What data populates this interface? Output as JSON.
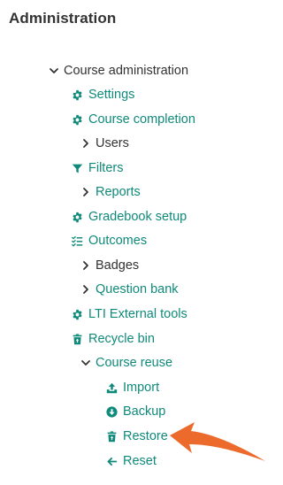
{
  "block": {
    "title": "Administration"
  },
  "tree": {
    "course_admin": "Course administration",
    "settings": "Settings",
    "course_completion": "Course completion",
    "users": "Users",
    "filters": "Filters",
    "reports": "Reports",
    "gradebook_setup": "Gradebook setup",
    "outcomes": "Outcomes",
    "badges": "Badges",
    "question_bank": "Question bank",
    "lti_external_tools": "LTI External tools",
    "recycle_bin": "Recycle bin",
    "course_reuse": "Course reuse",
    "import": "Import",
    "backup": "Backup",
    "restore": "Restore",
    "reset": "Reset"
  },
  "colors": {
    "link": "#0f8a7a",
    "text": "#333333",
    "callout_arrow": "#ec6a2c"
  },
  "icons": {
    "settings": "gear-icon",
    "course_completion": "gear-icon",
    "filters": "funnel-icon",
    "gradebook_setup": "gear-icon",
    "outcomes": "checklist-icon",
    "lti_external_tools": "gear-icon",
    "recycle_bin": "trash-icon",
    "import": "upload-icon",
    "backup": "download-circle-icon",
    "restore": "trash-restore-icon",
    "reset": "arrow-left-icon"
  }
}
